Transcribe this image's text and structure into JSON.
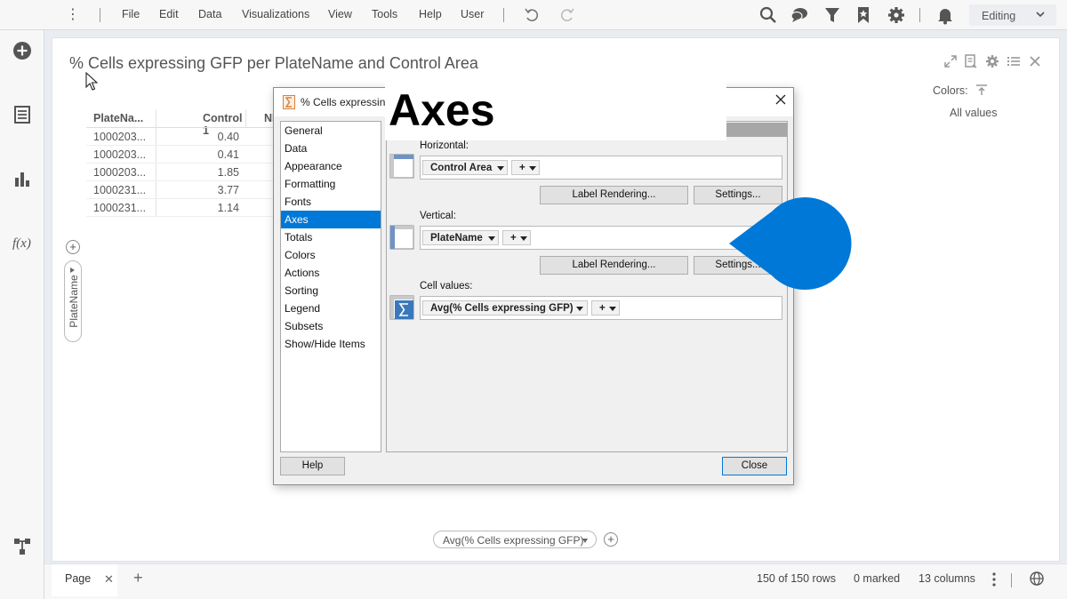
{
  "menu": {
    "items": [
      "File",
      "Edit",
      "Data",
      "Visualizations",
      "View",
      "Tools",
      "Help",
      "User"
    ],
    "mode": "Editing"
  },
  "icons": {
    "top": [
      "search-icon",
      "comment-icon",
      "filter-icon",
      "bookmark-icon",
      "gear-icon",
      "bell-icon"
    ],
    "left": [
      "add-icon",
      "data-table-icon",
      "bar-chart-icon",
      "function-icon",
      "data-flow-icon"
    ]
  },
  "visualization": {
    "title": "% Cells expressing GFP per PlateName and Control Area",
    "colors_label": "Colors:",
    "colors_value": "All values",
    "table": {
      "headers": [
        "PlateNa...",
        "Control 1",
        "NI"
      ],
      "rows": [
        {
          "name": "1000203...",
          "value": "0.40"
        },
        {
          "name": "1000203...",
          "value": "0.41"
        },
        {
          "name": "1000203...",
          "value": "1.85"
        },
        {
          "name": "1000231...",
          "value": "3.77"
        },
        {
          "name": "1000231...",
          "value": "1.14"
        }
      ]
    },
    "row_axis": "PlateName",
    "value_axis": "Avg(% Cells expressing GFP)",
    "add_symbol": "+"
  },
  "dialog": {
    "title": "% Cells expressing",
    "nav_items": [
      "General",
      "Data",
      "Appearance",
      "Formatting",
      "Fonts",
      "Axes",
      "Totals",
      "Colors",
      "Actions",
      "Sorting",
      "Legend",
      "Subsets",
      "Show/Hide Items"
    ],
    "selected": "Axes",
    "horizontal_label": "Horizontal:",
    "horizontal_column": "Control Area",
    "vertical_label": "Vertical:",
    "vertical_column": "PlateName",
    "cell_values_label": "Cell values:",
    "cell_values_column": "Avg(% Cells expressing GFP)",
    "plus": "+",
    "label_rendering": "Label Rendering...",
    "settings": "Settings...",
    "help": "Help",
    "close": "Close"
  },
  "overlay": {
    "text": "Axes",
    "color": "#0078d7"
  },
  "status": {
    "page_tab": "Page",
    "close_symbol": "✕",
    "add_symbol": "+",
    "rows": "150 of 150 rows",
    "marked": "0 marked",
    "columns": "13 columns"
  }
}
